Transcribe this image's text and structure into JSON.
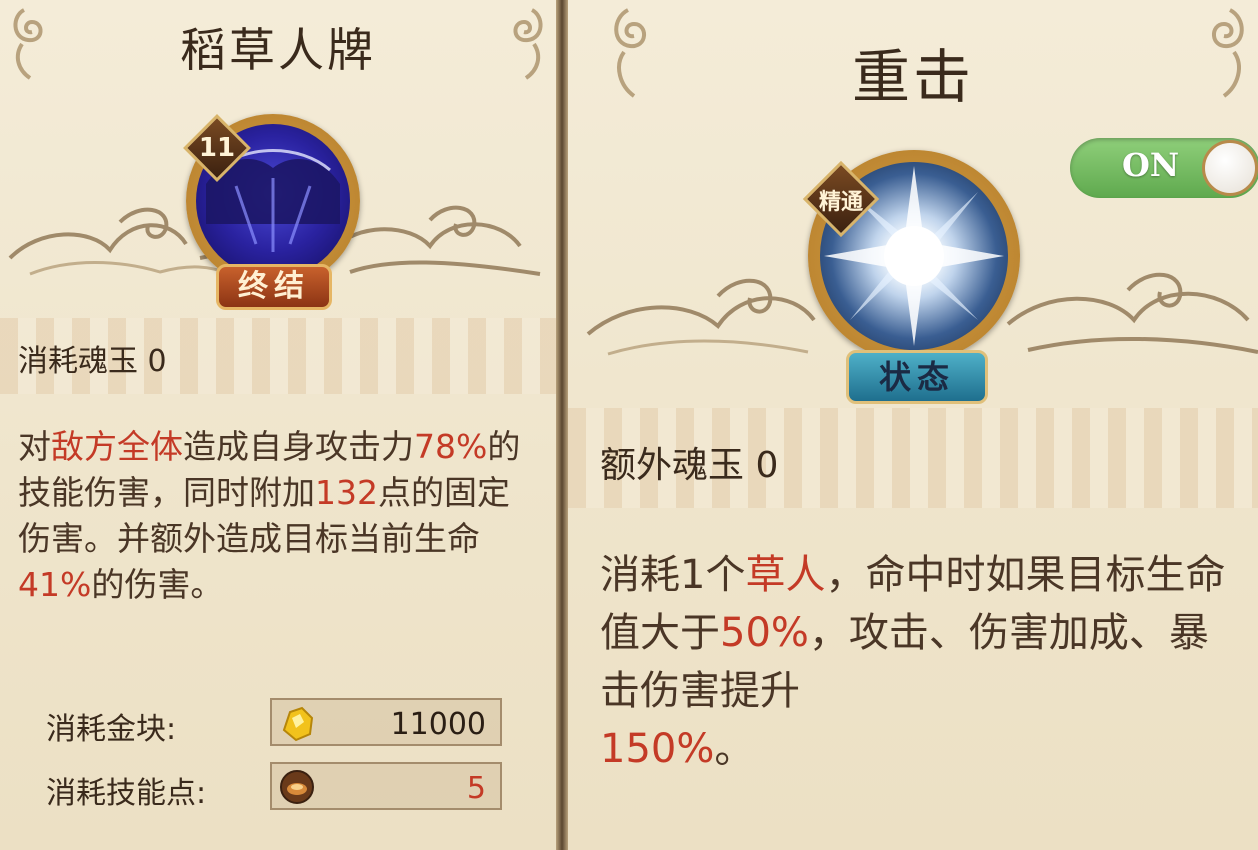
{
  "left_card": {
    "title": "稻草人牌",
    "level_badge": "11",
    "tag": "终结",
    "icon": "scarecrow-skill-icon",
    "soul_jade_label": "消耗魂玉",
    "soul_jade_value": "0",
    "description": {
      "p1": "对",
      "h1": "敌方全体",
      "p2": "造成自身攻击力",
      "h2": "78%",
      "p3": "的技能伤害，同时附加",
      "h3": "132",
      "p4": "点的固定伤害。并额外造成目标当前生命",
      "h4": "41%",
      "p5": "的伤害。"
    },
    "costs": [
      {
        "label": "消耗金块:",
        "icon": "gold-ore-icon",
        "value": "11000",
        "value_color": "#2a1e14"
      },
      {
        "label": "消耗技能点:",
        "icon": "skill-point-icon",
        "value": "5",
        "value_color": "#c43a26"
      }
    ]
  },
  "right_card": {
    "title": "重击",
    "badge": "精通",
    "tag": "状态",
    "icon": "burst-skill-icon",
    "toggle_label": "ON",
    "toggle_on": true,
    "soul_jade_label": "额外魂玉",
    "soul_jade_value": "0",
    "description": {
      "p1": "消耗1个",
      "h1": "草人",
      "p2": "，命中时如果目标生命值大于",
      "h2": "50%",
      "p3": "，攻击、伤害加成、暴击伤害提升",
      "h3": "150%",
      "p4": "。"
    }
  },
  "colors": {
    "highlight": "#c43a26",
    "text": "#3a2a1c",
    "parchment": "#f4ecd8",
    "toggle_green": "#6fb85c"
  }
}
